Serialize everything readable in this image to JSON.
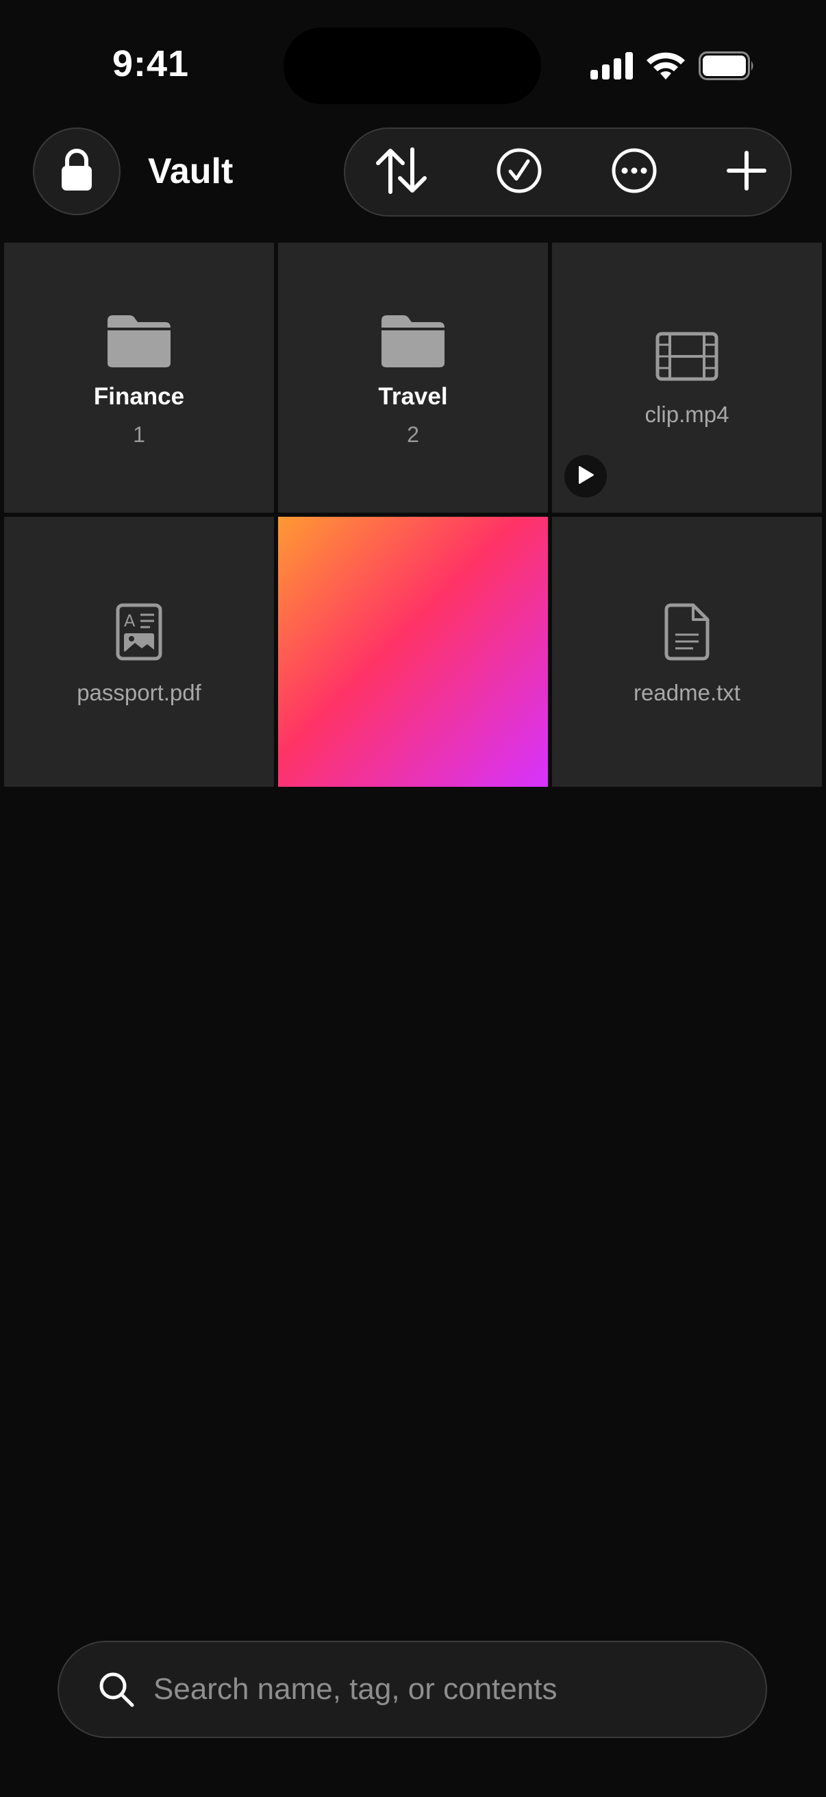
{
  "status_bar": {
    "time": "9:41",
    "icons": [
      "cellular-signal-icon",
      "wifi-icon",
      "battery-icon"
    ]
  },
  "header": {
    "lock_icon": "lock-icon",
    "title": "Vault",
    "toolbar": {
      "buttons": [
        {
          "name": "sort-button",
          "icon": "sort-arrows-icon"
        },
        {
          "name": "select-button",
          "icon": "checkmark-circle-icon"
        },
        {
          "name": "more-button",
          "icon": "ellipsis-circle-icon"
        },
        {
          "name": "add-button",
          "icon": "plus-icon"
        }
      ]
    }
  },
  "items": [
    {
      "type": "folder",
      "name": "Finance",
      "count": "1",
      "icon": "folder-icon"
    },
    {
      "type": "folder",
      "name": "Travel",
      "count": "2",
      "icon": "folder-icon"
    },
    {
      "type": "video",
      "name": "clip.mp4",
      "icon": "film-icon",
      "badge_icon": "play-icon"
    },
    {
      "type": "document",
      "name": "passport.pdf",
      "icon": "id-document-icon"
    },
    {
      "type": "image",
      "name": "",
      "icon": "image-thumbnail",
      "colors": [
        "#ff9933",
        "#ff3366",
        "#d633ff"
      ]
    },
    {
      "type": "text",
      "name": "readme.txt",
      "icon": "text-document-icon"
    }
  ],
  "search": {
    "placeholder": "Search name, tag, or contents",
    "value": ""
  },
  "colors": {
    "background": "#0b0b0b",
    "tile": "#262626",
    "text_primary": "#ffffff",
    "text_secondary": "#a8a8a8"
  }
}
